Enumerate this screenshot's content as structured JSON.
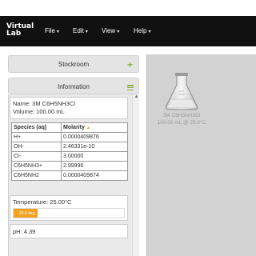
{
  "app": {
    "logo_line1": "Virtual",
    "logo_line2": "Lab"
  },
  "menu": {
    "file": "File",
    "edit": "Edit",
    "view": "View",
    "help": "Help"
  },
  "stockroom": {
    "title": "Stockroom"
  },
  "information": {
    "title": "Information",
    "name_label": "Name: 3M C6H5NH3Cl",
    "volume_label": "Volume: 100.00 mL",
    "table": {
      "headers": [
        "Species (aq)",
        "Molarity"
      ],
      "rows": [
        [
          "H+",
          "0.0000409876"
        ],
        [
          "OH-",
          "2.46331e-10"
        ],
        [
          "Cl-",
          "3.00000"
        ],
        [
          "C6H5NH3+",
          "2.99996"
        ],
        [
          "C6H5NH2",
          "0.0000409874"
        ]
      ]
    },
    "temperature_label": "Temperature: 25.00°C",
    "temperature_slider_label": "25.0 deg",
    "temperature_fill_fraction": 0.22,
    "ph_label": "pH: 4.39"
  },
  "workbench": {
    "flask_name": "3M C6H5NH3Cl",
    "flask_detail": "100.00 mL @ 25.0°C"
  },
  "colors": {
    "accent_green": "#8bb437",
    "slider_orange": "#f2a120",
    "topbar": "#111111"
  },
  "icons": {
    "stockroom": "plus-icon",
    "information": "menu-icon",
    "flask": "erlenmeyer-flask-icon"
  }
}
